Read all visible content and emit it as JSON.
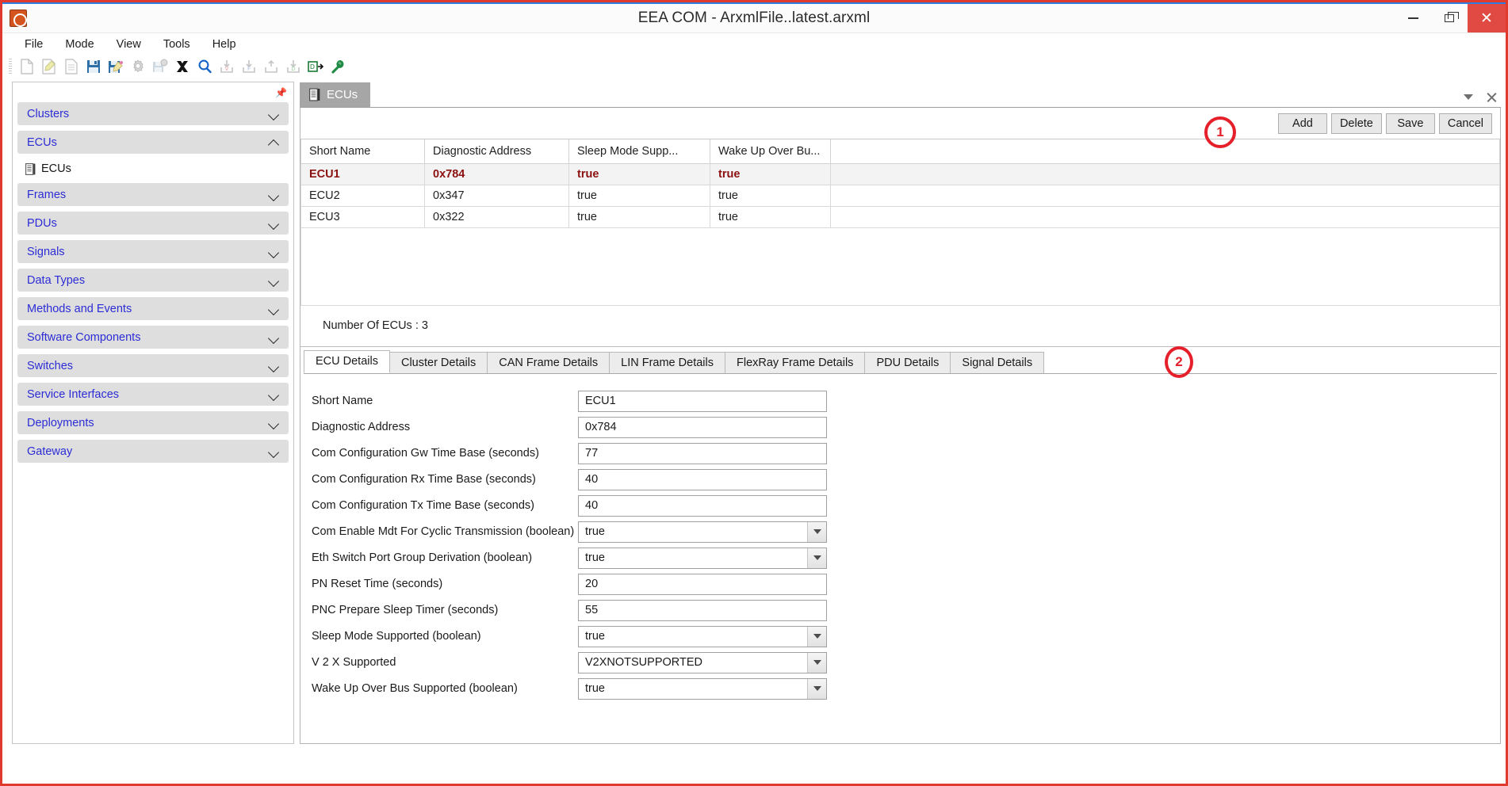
{
  "window": {
    "title": "EEA COM - ArxmlFile..latest.arxml",
    "app_icon": "app-logo-icon",
    "minimize_label": "Minimize",
    "maximize_label": "Restore",
    "close_label": "Close"
  },
  "menubar": {
    "items": [
      {
        "label": "File"
      },
      {
        "label": "Mode"
      },
      {
        "label": "View"
      },
      {
        "label": "Tools"
      },
      {
        "label": "Help"
      }
    ]
  },
  "toolbar": {
    "buttons": [
      {
        "icon": "new-file-icon",
        "enabled": false
      },
      {
        "icon": "edit-file-icon",
        "enabled": false
      },
      {
        "icon": "document-icon",
        "enabled": false
      },
      {
        "icon": "save-icon",
        "enabled": true
      },
      {
        "icon": "save-edit-icon",
        "enabled": true
      },
      {
        "icon": "settings-gear-icon",
        "enabled": false
      },
      {
        "icon": "save-settings-icon",
        "enabled": false
      },
      {
        "icon": "close-x-icon",
        "enabled": true
      },
      {
        "icon": "search-icon",
        "enabled": true
      },
      {
        "icon": "import-v-icon",
        "enabled": false
      },
      {
        "icon": "import-f-icon",
        "enabled": false
      },
      {
        "icon": "import-icon",
        "enabled": false
      },
      {
        "icon": "import-d-icon",
        "enabled": false
      },
      {
        "icon": "export-d-icon",
        "enabled": true
      },
      {
        "icon": "wrench-icon",
        "enabled": true
      }
    ]
  },
  "sidebar": {
    "pin_icon": "pin-icon",
    "items": [
      {
        "label": "Clusters",
        "expanded": false,
        "chevron": "chevron-down-icon"
      },
      {
        "label": "ECUs",
        "expanded": true,
        "chevron": "chevron-up-icon",
        "children": [
          {
            "label": "ECUs",
            "icon": "list-document-icon"
          }
        ]
      },
      {
        "label": "Frames",
        "expanded": false,
        "chevron": "chevron-down-icon"
      },
      {
        "label": "PDUs",
        "expanded": false,
        "chevron": "chevron-down-icon"
      },
      {
        "label": "Signals",
        "expanded": false,
        "chevron": "chevron-down-icon"
      },
      {
        "label": "Data Types",
        "expanded": false,
        "chevron": "chevron-down-icon"
      },
      {
        "label": "Methods and Events",
        "expanded": false,
        "chevron": "chevron-down-icon"
      },
      {
        "label": "Software Components",
        "expanded": false,
        "chevron": "chevron-down-icon"
      },
      {
        "label": "Switches",
        "expanded": false,
        "chevron": "chevron-down-icon"
      },
      {
        "label": "Service Interfaces",
        "expanded": false,
        "chevron": "chevron-down-icon"
      },
      {
        "label": "Deployments",
        "expanded": false,
        "chevron": "chevron-down-icon"
      },
      {
        "label": "Gateway",
        "expanded": false,
        "chevron": "chevron-down-icon"
      }
    ]
  },
  "document_tabs": {
    "tabs": [
      {
        "label": "ECUs",
        "icon": "list-document-icon",
        "active": true
      }
    ],
    "dropdown_icon": "chevron-down-icon",
    "close_icon": "close-icon"
  },
  "actions": {
    "add_label": "Add",
    "delete_label": "Delete",
    "save_label": "Save",
    "cancel_label": "Cancel"
  },
  "grid": {
    "columns": [
      "Short Name",
      "Diagnostic Address",
      "Sleep Mode Supp...",
      "Wake Up Over Bu...",
      ""
    ],
    "rows": [
      {
        "cells": [
          "ECU1",
          "0x784",
          "true",
          "true",
          ""
        ],
        "selected": true
      },
      {
        "cells": [
          "ECU2",
          "0x347",
          "true",
          "true",
          ""
        ],
        "selected": false
      },
      {
        "cells": [
          "ECU3",
          "0x322",
          "true",
          "true",
          ""
        ],
        "selected": false
      }
    ],
    "count_label": "Number Of ECUs : 3",
    "selected_row_color": "#8b1111"
  },
  "detail_tabs": {
    "tabs": [
      {
        "label": "ECU Details",
        "active": true
      },
      {
        "label": "Cluster Details",
        "active": false
      },
      {
        "label": "CAN Frame Details",
        "active": false
      },
      {
        "label": "LIN Frame Details",
        "active": false
      },
      {
        "label": "FlexRay Frame Details",
        "active": false
      },
      {
        "label": "PDU Details",
        "active": false
      },
      {
        "label": "Signal Details",
        "active": false
      }
    ]
  },
  "form": {
    "fields": [
      {
        "label": "Short Name",
        "value": "ECU1",
        "type": "text"
      },
      {
        "label": "Diagnostic Address",
        "value": "0x784",
        "type": "text"
      },
      {
        "label": "Com Configuration Gw Time Base (seconds)",
        "value": "77",
        "type": "text"
      },
      {
        "label": "Com Configuration Rx Time Base (seconds)",
        "value": "40",
        "type": "text"
      },
      {
        "label": "Com Configuration Tx Time Base (seconds)",
        "value": "40",
        "type": "text"
      },
      {
        "label": "Com Enable Mdt For Cyclic Transmission (boolean)",
        "value": "true",
        "type": "select"
      },
      {
        "label": "Eth Switch Port Group Derivation (boolean)",
        "value": "true",
        "type": "select"
      },
      {
        "label": "PN Reset Time (seconds)",
        "value": "20",
        "type": "text"
      },
      {
        "label": "PNC Prepare Sleep Timer (seconds)",
        "value": "55",
        "type": "text"
      },
      {
        "label": "Sleep Mode Supported (boolean)",
        "value": "true",
        "type": "select"
      },
      {
        "label": "V 2 X Supported",
        "value": "V2XNOTSUPPORTED",
        "type": "select"
      },
      {
        "label": "Wake Up Over Bus Supported (boolean)",
        "value": "true",
        "type": "select"
      }
    ]
  },
  "annotations": [
    {
      "label": "1"
    },
    {
      "label": "2"
    }
  ],
  "colors": {
    "annotation_red": "#e5202a",
    "window_border_red": "#e03a2f",
    "title_accent_blue": "#2b7de0",
    "sidebar_link_blue": "#2c2cd6",
    "selected_row_text": "#8b1111"
  }
}
